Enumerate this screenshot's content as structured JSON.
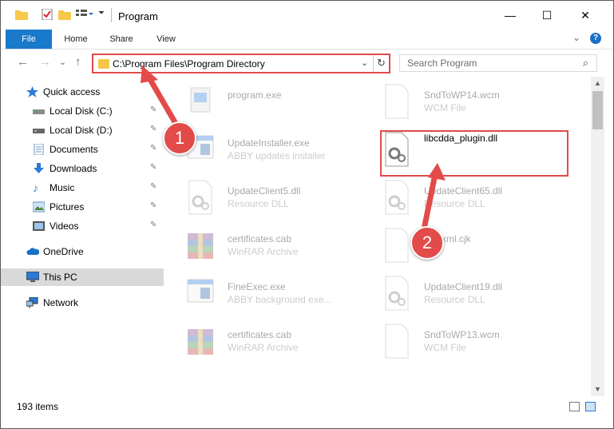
{
  "window": {
    "title": "Program",
    "controls": {
      "minimize": "—",
      "maximize": "☐",
      "close": "✕"
    }
  },
  "ribbon": {
    "tabs": [
      "File",
      "Home",
      "Share",
      "View"
    ],
    "expand": "⌄",
    "help": "?"
  },
  "nav": {
    "back": "←",
    "forward": "→",
    "recent": "⌄",
    "up": "↑",
    "address": "C:\\Program Files\\Program Directory",
    "address_drop": "⌄",
    "refresh": "↻",
    "search_placeholder": "Search Program",
    "search_glyph": "⌕"
  },
  "sidebar": {
    "items": [
      {
        "label": "Quick access",
        "icon": "star-icon"
      },
      {
        "label": "Local Disk (C:)",
        "icon": "drive-icon",
        "pinned": true
      },
      {
        "label": "Local Disk (D:)",
        "icon": "drive-icon",
        "pinned": true
      },
      {
        "label": "Documents",
        "icon": "documents-icon",
        "pinned": true
      },
      {
        "label": "Downloads",
        "icon": "downloads-icon",
        "pinned": true
      },
      {
        "label": "Music",
        "icon": "music-icon",
        "pinned": true
      },
      {
        "label": "Pictures",
        "icon": "pictures-icon",
        "pinned": true
      },
      {
        "label": "Videos",
        "icon": "videos-icon",
        "pinned": true
      },
      {
        "label": "OneDrive",
        "icon": "onedrive-icon"
      },
      {
        "label": "This PC",
        "icon": "computer-icon",
        "selected": true
      },
      {
        "label": "Network",
        "icon": "network-icon"
      }
    ],
    "pin_glyph": "✎"
  },
  "files": {
    "left": [
      {
        "name": "program.exe",
        "type": "",
        "icon": "exe-icon"
      },
      {
        "name": "UpdateInstaller.exe",
        "type": "ABBY updates installer",
        "icon": "installer-icon"
      },
      {
        "name": "UpdateClient5.dll",
        "type": "Resource DLL",
        "icon": "dll-icon"
      },
      {
        "name": "certificates.cab",
        "type": "WinRAR Archive",
        "icon": "archive-icon"
      },
      {
        "name": "FineExec.exe",
        "type": "ABBY background exe...",
        "icon": "installer-icon"
      },
      {
        "name": "certificates.cab",
        "type": "WinRAR Archive",
        "icon": "archive-icon"
      }
    ],
    "right": [
      {
        "name": "SndToWP14.wcm",
        "type": "WCM File",
        "icon": "blank-file-icon"
      },
      {
        "name": "libcdda_plugin.dll",
        "type": "",
        "icon": "dll-icon",
        "highlighted": true
      },
      {
        "name": "UpdateClient65.dll",
        "type": "Resource DLL",
        "icon": "dll-icon"
      },
      {
        "name": "gimixml.cjk",
        "type": "File",
        "icon": "blank-file-icon"
      },
      {
        "name": "UpdateClient19.dll",
        "type": "Resource DLL",
        "icon": "dll-icon"
      },
      {
        "name": "SndToWP13.wcm",
        "type": "WCM File",
        "icon": "blank-file-icon"
      }
    ]
  },
  "status": {
    "count": "193 items"
  },
  "annotations": {
    "step1": "1",
    "step2": "2"
  },
  "colors": {
    "accent": "#1979ca",
    "highlight": "#e24a4a",
    "folder": "#f5c84c"
  }
}
